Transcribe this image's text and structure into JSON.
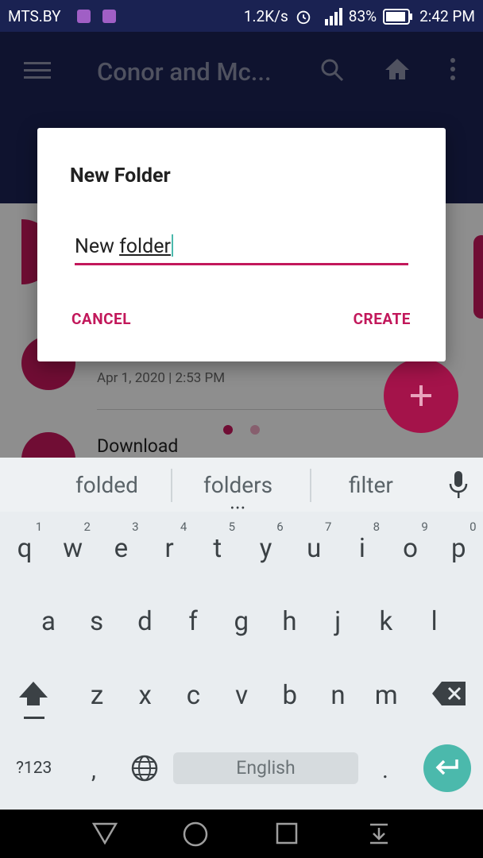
{
  "status_bar": {
    "carrier": "MTS.BY",
    "speed": "1.2K/s",
    "battery_pct": "83%",
    "time": "2:42 PM"
  },
  "app_bar": {
    "title": "Conor and Mc..."
  },
  "background_list": {
    "date_text": "Apr 1, 2020 | 2:53 PM",
    "item_name": "Download"
  },
  "dialog": {
    "title": "New Folder",
    "input_prefix": "New ",
    "input_word": "folder",
    "cancel_label": "CANCEL",
    "create_label": "CREATE"
  },
  "keyboard": {
    "suggestions": [
      "folded",
      "folders",
      "filter"
    ],
    "row1": [
      "q",
      "w",
      "e",
      "r",
      "t",
      "y",
      "u",
      "i",
      "o",
      "p"
    ],
    "row1_hints": [
      "1",
      "2",
      "3",
      "4",
      "5",
      "6",
      "7",
      "8",
      "9",
      "0"
    ],
    "row2": [
      "a",
      "s",
      "d",
      "f",
      "g",
      "h",
      "j",
      "k",
      "l"
    ],
    "row3": [
      "z",
      "x",
      "c",
      "v",
      "b",
      "n",
      "m"
    ],
    "symbols_label": "?123",
    "comma": ",",
    "period": ".",
    "space_label": "English"
  },
  "colors": {
    "accent": "#c2185b",
    "appbar": "#1a2252",
    "enter": "#4bb9ac"
  }
}
